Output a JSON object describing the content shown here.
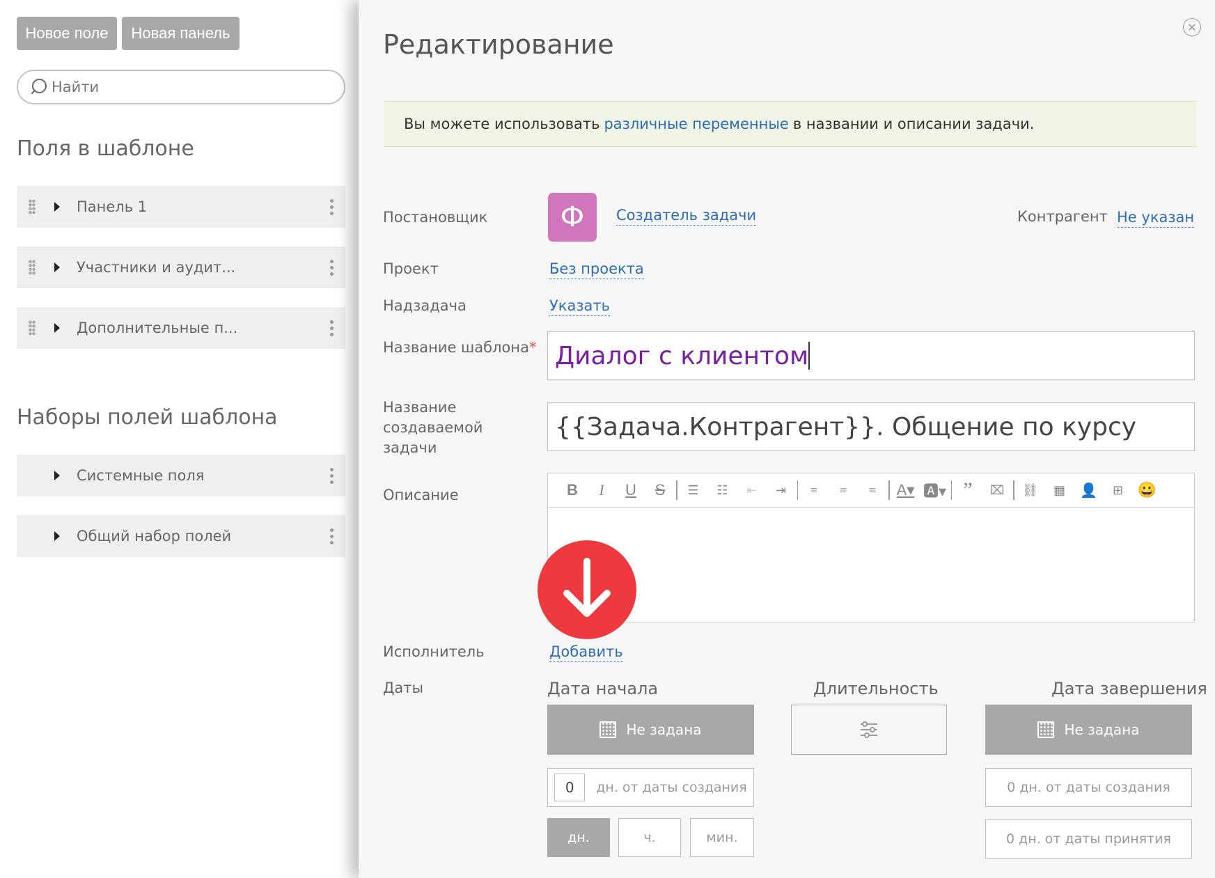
{
  "left": {
    "new_field_btn": "Новое поле",
    "new_panel_btn": "Новая панель",
    "search_placeholder": "Найти",
    "fields_title": "Поля в шаблоне",
    "fields": [
      {
        "label": "Панель 1"
      },
      {
        "label": "Участники и аудит..."
      },
      {
        "label": "Дополнительные п..."
      }
    ],
    "sets_title": "Наборы полей шаблона",
    "sets": [
      {
        "label": "Системные поля"
      },
      {
        "label": "Общий набор полей"
      }
    ]
  },
  "modal": {
    "close": "✕",
    "title": "Редактирование",
    "info_before": "Вы можете использовать",
    "info_link": "различные переменные",
    "info_after": "в названии и описании задачи.",
    "postanovshik_label": "Постановщик",
    "avatar_letter": "Ф",
    "postanovshik_value": "Создатель задачи",
    "kontragent_label": "Контрагент",
    "kontragent_value": "Не указан",
    "project_label": "Проект",
    "project_value": "Без проекта",
    "parent_label": "Надзадача",
    "parent_value": "Указать",
    "template_name_label": "Название шаблона",
    "required_mark": "*",
    "template_name_value": "Диалог с клиентом",
    "task_name_label_1": "Название",
    "task_name_label_2": "создаваемой",
    "task_name_label_3": "задачи",
    "task_name_value": "{{Задача.Контрагент}}. Общение по курсу",
    "description_label": "Описание",
    "executor_label": "Исполнитель",
    "executor_value": "Добавить",
    "dates_label": "Даты",
    "start_date_label": "Дата начала",
    "duration_label": "Длительность",
    "end_date_label": "Дата завершения",
    "start_date_btn": "Не задана",
    "end_date_btn": "Не задана",
    "start_offset_value": "0",
    "start_offset_text": "дн. от даты создания",
    "end_offset_created": "0 дн. от даты создания",
    "end_offset_accepted": "0 дн. от даты принятия",
    "units": [
      "дн.",
      "ч.",
      "мин."
    ]
  },
  "colors": {
    "accent_link": "#2e6db4",
    "avatar": "#d176bd",
    "gray_button": "#a8a8a8",
    "red_arrow": "#ee3a3f",
    "template_name_text": "#7a1fa2"
  }
}
